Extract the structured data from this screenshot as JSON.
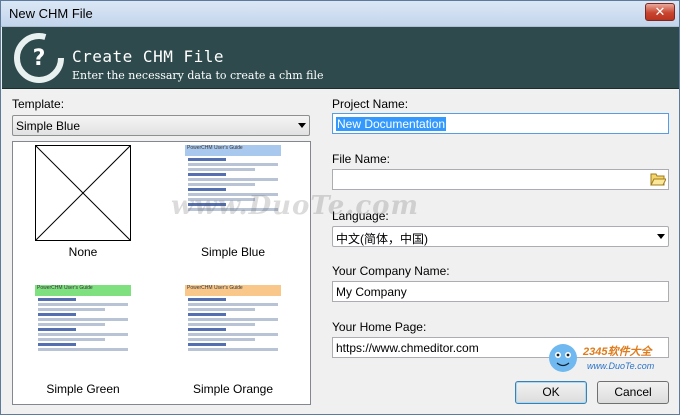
{
  "window": {
    "title": "New CHM File",
    "close_glyph": "✕"
  },
  "banner": {
    "heading": "Create CHM File",
    "subheading": "Enter the necessary data to create a chm file",
    "icon": "help-question-icon"
  },
  "template": {
    "label": "Template:",
    "selected": "Simple Blue",
    "tiles": [
      {
        "caption": "None"
      },
      {
        "caption": "Simple Blue",
        "header_color": "#a8c8ee",
        "thumb_title": "PowerCHM User's Guide"
      },
      {
        "caption": "Simple Green",
        "header_color": "#7ee07e",
        "thumb_title": "PowerCHM User's Guide"
      },
      {
        "caption": "Simple Orange",
        "header_color": "#f9c78a",
        "thumb_title": "PowerCHM User's Guide"
      }
    ]
  },
  "project_name": {
    "label": "Project Name:",
    "value": "New Documentation"
  },
  "file_name": {
    "label": "File Name:",
    "value": "",
    "browse_icon": "folder-open-icon"
  },
  "language": {
    "label": "Language:",
    "selected": "中文(简体，中国)"
  },
  "company": {
    "label": "Your Company Name:",
    "value": "My Company"
  },
  "home_page": {
    "label": "Your Home Page:",
    "value": "https://www.chmeditor.com"
  },
  "buttons": {
    "ok": "OK",
    "cancel": "Cancel"
  },
  "watermarks": {
    "center": "www.DuoTe.com",
    "corner_top": "2345软件大全",
    "corner_bottom": "www.DuoTe.com"
  }
}
